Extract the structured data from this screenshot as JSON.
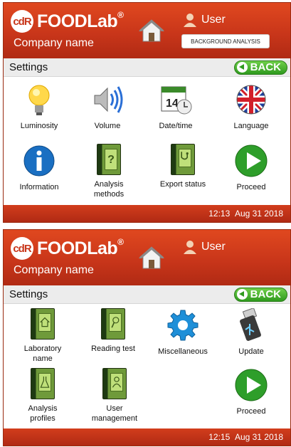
{
  "screens": [
    {
      "header": {
        "brand": "FOODLab",
        "reg": "®",
        "company": "Company name",
        "user": "User",
        "mode_button": "BACKGROUND ANALYSIS"
      },
      "bar": {
        "title": "Settings",
        "back": "BACK"
      },
      "tiles": [
        "Luminosity",
        "Volume",
        "Date/time",
        "Language",
        "Information",
        "Analysis methods",
        "Export status",
        "Proceed"
      ],
      "footer": {
        "time": "12:13",
        "date": "Aug 31 2018"
      }
    },
    {
      "header": {
        "brand": "FOODLab",
        "reg": "®",
        "company": "Company name",
        "user": "User"
      },
      "bar": {
        "title": "Settings",
        "back": "BACK"
      },
      "tiles": [
        "Laboratory name",
        "Reading test",
        "Miscellaneous",
        "Update",
        "Analysis profiles",
        "User management",
        "Proceed"
      ],
      "footer": {
        "time": "12:15",
        "date": "Aug 31 2018"
      }
    }
  ],
  "logo_text": "cdR",
  "icons": [
    "home-icon",
    "user-icon",
    "back-arrow-icon",
    "bulb-icon",
    "speaker-icon",
    "calendar-clock-icon",
    "uk-flag-icon",
    "info-icon",
    "book-question-icon",
    "book-stethoscope-icon",
    "play-icon",
    "book-home-icon",
    "book-magnifier-icon",
    "gear-icon",
    "usb-icon",
    "book-flask-icon",
    "book-person-icon"
  ],
  "colors": {
    "header": "#c9361a",
    "accent_green": "#2f9a1e",
    "footer": "#b02a14"
  }
}
